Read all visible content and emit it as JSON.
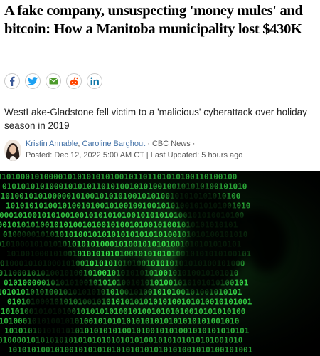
{
  "article": {
    "headline": "A fake company, unsuspecting 'money mules' and bitcoin: How a Manitoba municipality lost $430K",
    "deck": "WestLake-Gladstone fell victim to a 'malicious' cyberattack over holiday season in 2019",
    "authors": [
      "Kristin Annable",
      "Caroline Barghout"
    ],
    "author_separator": ", ",
    "source": " · CBC News · ",
    "posted": "Posted: Dec 12, 2022 5:00 AM CT",
    "meta_separator": " | ",
    "updated": "Last Updated: 5 hours ago"
  },
  "share": [
    {
      "name": "facebook-icon",
      "glyph": "f",
      "color": "#3b5998"
    },
    {
      "name": "twitter-icon",
      "glyph": "",
      "color": "#1da1f2"
    },
    {
      "name": "email-icon",
      "glyph": "",
      "color": "#4c9a2a"
    },
    {
      "name": "reddit-icon",
      "glyph": "",
      "color": "#ff4500"
    },
    {
      "name": "linkedin-icon",
      "glyph": "in",
      "color": "#0e76a8"
    }
  ],
  "hero_image": {
    "binary_lines": [
      "1010100010100001010101010100101101101010100110100100",
      "0101010101000101010110101001010100100101010100101010",
      "0101001010100000101001010101001010100101010101010100",
      "1010101010010100101001010010010010101001010101001010",
      "0001010010101001001010101010010101010100101010010100",
      "1001010101001010100101001010010100101001010101010101",
      "0100000101010101001010101010101010100101010100101010",
      "0101000101010101010101000101001010101001010101010101",
      "1010010001010010101010101001010101010010101010100101",
      "0100010101000101001010101010100101010101010100101000",
      "1011000101010010100101001010101010100101010010101010",
      "0101000001010101001010101001010101001010101010100101",
      "1010101010100101010101010100101001010100101001010101",
      "0101010001010101001010101010101010100101010010101001",
      "1010100101010100101010101001010010101010010101010100",
      "0101000101010010101001010101010101010101010101001010",
      "1010101010101010101010101001010010101001010101010101",
      "0100001010101010101010101010101001010101010101001010",
      "1010101001010010101010101010101010101001010100101001"
    ],
    "glow_color": "#3cf050"
  }
}
